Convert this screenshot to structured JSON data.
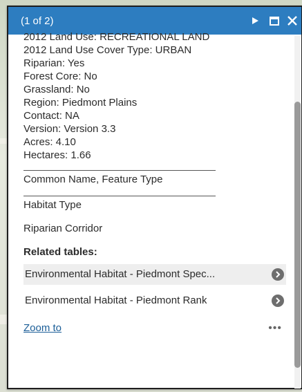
{
  "popup": {
    "title": "(1 of 2)",
    "attributes": [
      "2012 Land Use: RECREATIONAL LAND",
      "2012 Land Use Cover Type: URBAN",
      "Riparian: Yes",
      "Forest Core: No",
      "Grassland: No",
      "Region: Piedmont Plains",
      "Contact: NA",
      "Version: Version 3.3",
      "Acres: 4.10",
      "Hectares: 1.66"
    ],
    "common_name_label": "Common Name, Feature Type",
    "habitat_type_label": "Habitat Type",
    "habitat_value": "Riparian Corridor",
    "related_tables_label": "Related tables:",
    "related_tables": [
      "Environmental Habitat - Piedmont Spec...",
      "Environmental Habitat - Piedmont Rank"
    ],
    "zoom_to_label": "Zoom to",
    "more_label": "•••"
  },
  "colors": {
    "header": "#2d7dc0",
    "link": "#1a5d97"
  },
  "icons": [
    "next-icon",
    "maximize-icon",
    "close-icon",
    "arrow-right-icon",
    "more-options-icon"
  ]
}
